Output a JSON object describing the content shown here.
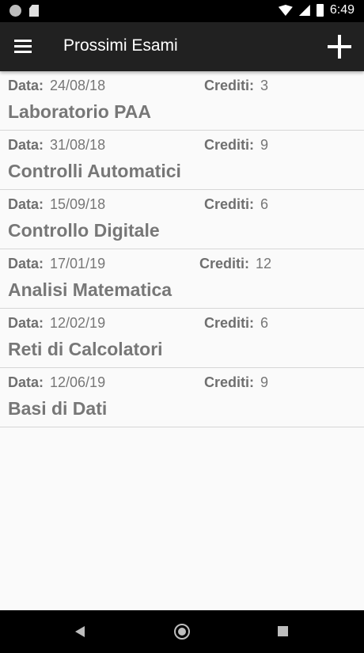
{
  "status_bar": {
    "time": "6:49",
    "icons": [
      "notification-dot-icon",
      "sd-card-icon",
      "wifi-icon",
      "signal-icon",
      "battery-icon"
    ]
  },
  "app_bar": {
    "title": "Prossimi Esami",
    "menu_icon": "menu-icon",
    "add_icon": "add-icon"
  },
  "labels": {
    "date": "Data:",
    "credits": "Crediti:"
  },
  "exams": [
    {
      "date": "24/08/18",
      "credits": "3",
      "name": "Laboratorio PAA"
    },
    {
      "date": "31/08/18",
      "credits": "9",
      "name": "Controlli Automatici"
    },
    {
      "date": "15/09/18",
      "credits": "6",
      "name": "Controllo Digitale"
    },
    {
      "date": "17/01/19",
      "credits": "12",
      "name": "Analisi Matematica"
    },
    {
      "date": "12/02/19",
      "credits": "6",
      "name": "Reti di Calcolatori"
    },
    {
      "date": "12/06/19",
      "credits": "9",
      "name": "Basi di Dati"
    }
  ],
  "nav_bar": {
    "icons": [
      "back-icon",
      "home-icon",
      "recents-icon"
    ]
  },
  "colors": {
    "app_bar": "#212121",
    "background": "#fafafa",
    "text": "#777777",
    "divider": "#d6d6d6"
  }
}
